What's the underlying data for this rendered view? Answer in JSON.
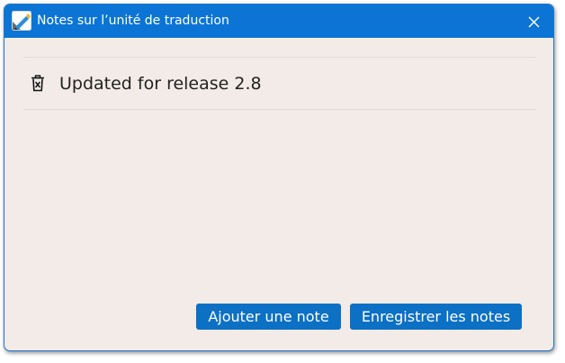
{
  "window": {
    "title": "Notes sur l’unité de traduction",
    "icon": "app-pen-icon",
    "close_icon": "close-icon"
  },
  "notes": [
    {
      "text": "Updated for release 2.8",
      "delete_icon": "trash-icon"
    }
  ],
  "buttons": {
    "add_note": "Ajouter une note",
    "save_notes": "Enregistrer les notes"
  },
  "colors": {
    "titlebar": "#0b74d5",
    "background": "#f2ebe7",
    "button": "#0c70c4"
  }
}
